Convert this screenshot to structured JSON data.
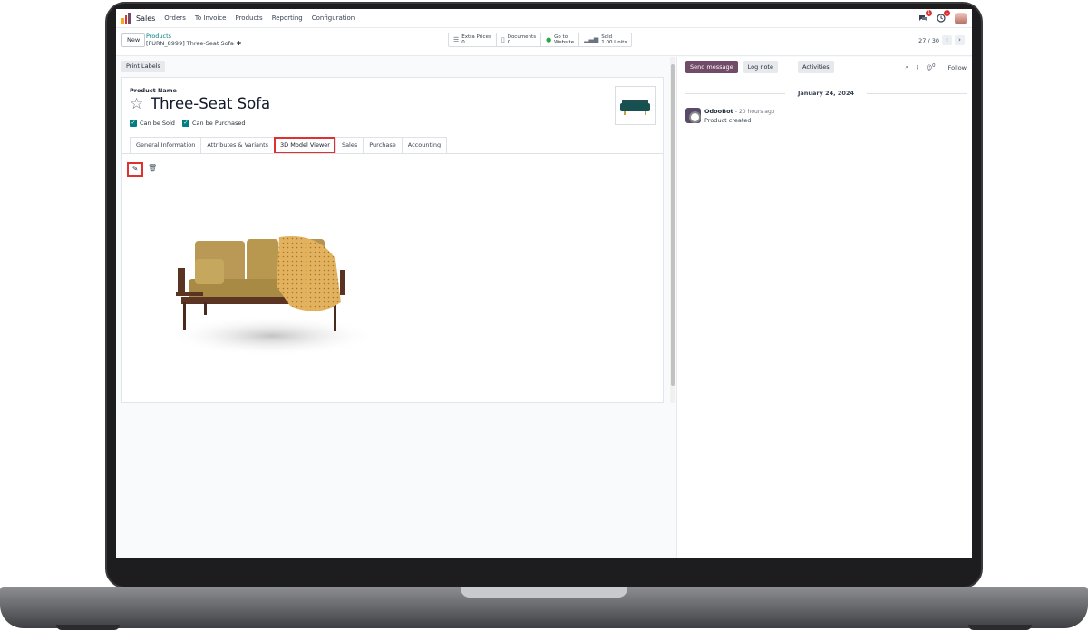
{
  "navbar": {
    "app_name": "Sales",
    "menu": [
      "Orders",
      "To Invoice",
      "Products",
      "Reporting",
      "Configuration"
    ],
    "messages_badge": "1",
    "activities_badge": "1"
  },
  "control": {
    "new_label": "New",
    "breadcrumb_parent": "Products",
    "breadcrumb_current": "[FURN_8999] Three-Seat Sofa",
    "smart_buttons": [
      {
        "label": "Extra Prices",
        "value": "0",
        "icon": "list-icon"
      },
      {
        "label": "Documents",
        "value": "0",
        "icon": "file-icon"
      },
      {
        "label": "Go to",
        "value": "Website",
        "icon": "globe-icon"
      },
      {
        "label": "Sold",
        "value": "1.00 Units",
        "icon": "chart-icon"
      }
    ],
    "pager": "27 / 30"
  },
  "form": {
    "print_labels": "Print Labels",
    "product_name_label": "Product Name",
    "product_name": "Three-Seat Sofa",
    "can_be_sold": "Can be Sold",
    "can_be_purchased": "Can be Purchased",
    "tabs": [
      "General Information",
      "Attributes & Variants",
      "3D Model Viewer",
      "Sales",
      "Purchase",
      "Accounting"
    ],
    "active_tab": "3D Model Viewer"
  },
  "chatter": {
    "send_message": "Send message",
    "log_note": "Log note",
    "activities": "Activities",
    "attachments_count": "0",
    "follow": "Follow",
    "date": "January 24, 2024",
    "author": "OdooBot",
    "time": "- 20 hours ago",
    "body": "Product created"
  },
  "colors": {
    "primary": "#714b67",
    "teal": "#017e84",
    "highlight": "#e03131"
  }
}
